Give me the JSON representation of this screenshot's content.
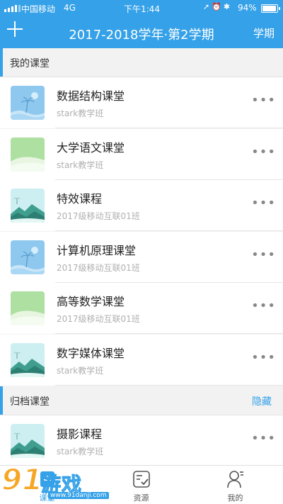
{
  "status_bar": {
    "carrier": "中国移动",
    "network": "4G",
    "time": "下午1:44",
    "battery": "94%"
  },
  "header": {
    "title": "2017-2018学年·第2学期",
    "term_button": "学期"
  },
  "my_classes": {
    "title": "我的课堂",
    "courses": [
      {
        "name": "数据结构课堂",
        "class": "stark教学班",
        "thumb": "blue-palm"
      },
      {
        "name": "大学语文课堂",
        "class": "stark教学班",
        "thumb": "green-hill"
      },
      {
        "name": "特效课程",
        "class": "2017级移动互联01班",
        "thumb": "mountain"
      },
      {
        "name": "计算机原理课堂",
        "class": "2017级移动互联01班",
        "thumb": "blue-palm"
      },
      {
        "name": "高等数学课堂",
        "class": "2017级移动互联01班",
        "thumb": "green-hill"
      },
      {
        "name": "数字媒体课堂",
        "class": "stark教学班",
        "thumb": "mountain"
      }
    ]
  },
  "archived": {
    "title": "归档课堂",
    "hide_button": "隐藏",
    "courses": [
      {
        "name": "摄影课程",
        "class": "stark教学班",
        "thumb": "mountain"
      }
    ]
  },
  "more_label": "•••",
  "tabs": [
    {
      "label": "课堂",
      "icon": "classroom-icon",
      "active": true
    },
    {
      "label": "资源",
      "icon": "resource-icon",
      "active": false
    },
    {
      "label": "我的",
      "icon": "profile-icon",
      "active": false
    }
  ],
  "watermark": {
    "logo": "91",
    "text": "游戏",
    "url": "www.91danji.com"
  },
  "colors": {
    "accent": "#35a1e8",
    "background": "#f2f2f2"
  }
}
